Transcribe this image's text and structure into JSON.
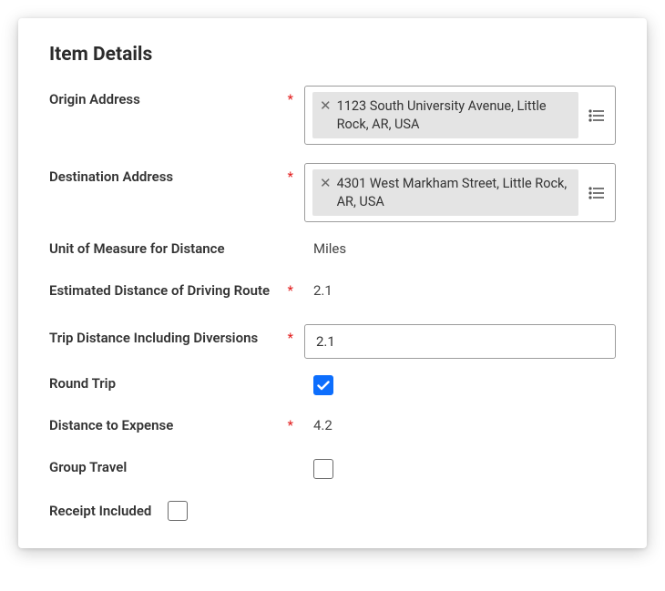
{
  "title": "Item Details",
  "fields": {
    "origin": {
      "label": "Origin Address",
      "required": true,
      "value": "1123 South University Avenue, Little Rock, AR, USA"
    },
    "destination": {
      "label": "Destination Address",
      "required": true,
      "value": "4301 West Markham Street, Little Rock, AR, USA"
    },
    "unit_of_measure": {
      "label": "Unit of Measure for Distance",
      "value": "Miles"
    },
    "estimated_distance": {
      "label": "Estimated Distance of Driving Route",
      "required": true,
      "value": "2.1"
    },
    "trip_distance": {
      "label": "Trip Distance Including Diversions",
      "required": true,
      "value": "2.1"
    },
    "round_trip": {
      "label": "Round Trip",
      "checked": true
    },
    "distance_to_expense": {
      "label": "Distance to Expense",
      "required": true,
      "value": "4.2"
    },
    "group_travel": {
      "label": "Group Travel",
      "checked": false
    },
    "receipt_included": {
      "label": "Receipt Included",
      "checked": false
    }
  },
  "required_marker": "*"
}
